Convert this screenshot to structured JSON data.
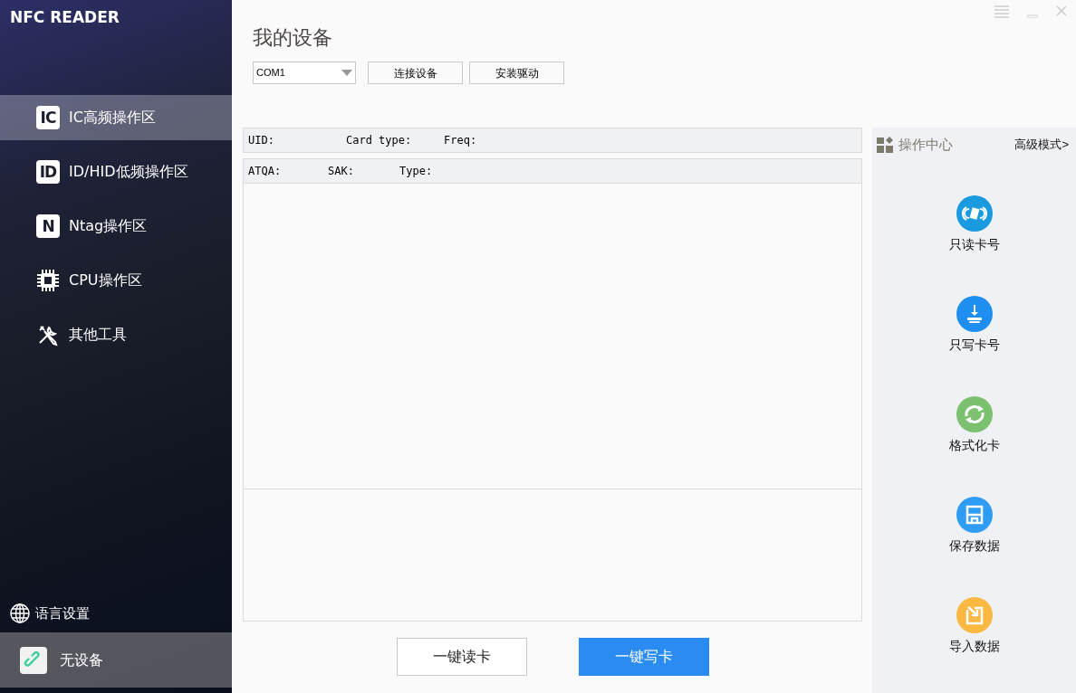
{
  "app_title": "NFC READER",
  "sidebar": {
    "items": [
      {
        "kind": "letters",
        "badge": "IC",
        "label": "IC高频操作区",
        "selected": true
      },
      {
        "kind": "letters",
        "badge": "ID",
        "label": "ID/HID低频操作区",
        "selected": false
      },
      {
        "kind": "letters",
        "badge": "N",
        "label": "Ntag操作区",
        "selected": false
      },
      {
        "kind": "chip",
        "label": "CPU操作区",
        "selected": false
      },
      {
        "kind": "tools",
        "label": "其他工具",
        "selected": false
      }
    ],
    "language": "语言设置",
    "device_status": "无设备"
  },
  "page_title": "我的设备",
  "port_select": {
    "value": "COM1"
  },
  "top_buttons": [
    "连接设备",
    "安装驱动"
  ],
  "info_rows": [
    [
      "UID:",
      "Card type:",
      "Freq:"
    ],
    [
      "ATQA:",
      "SAK:",
      "Type:"
    ]
  ],
  "bottom_buttons": [
    {
      "label": "一键读卡",
      "kind": "outline"
    },
    {
      "label": "一键写卡",
      "kind": "primary"
    }
  ],
  "ops_panel": {
    "title": "操作中心",
    "advanced": "高级模式>",
    "actions": [
      {
        "kind": "read",
        "label": "只读卡号",
        "color": "#1a9be0"
      },
      {
        "kind": "write",
        "label": "只写卡号",
        "color": "#1e8ff0"
      },
      {
        "kind": "format",
        "label": "格式化卡",
        "color": "#7cc16f"
      },
      {
        "kind": "save",
        "label": "保存数据",
        "color": "#2f9cf5"
      },
      {
        "kind": "import",
        "label": "导入数据",
        "color": "#fbb843"
      }
    ]
  }
}
